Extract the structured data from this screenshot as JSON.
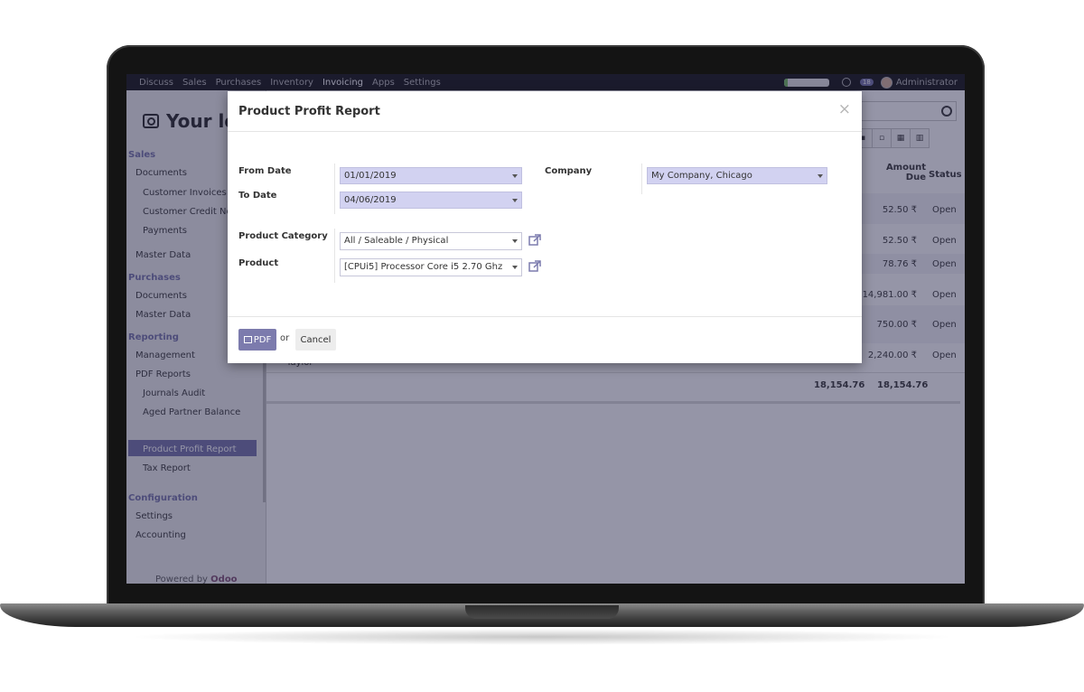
{
  "topbar": {
    "menu": [
      "Discuss",
      "Sales",
      "Purchases",
      "Inventory",
      "Invoicing",
      "Apps",
      "Settings"
    ],
    "active": "Invoicing",
    "chat_count": "18",
    "user": "Administrator"
  },
  "sidebar": {
    "logo_text": "Your lo",
    "sales": {
      "heading": "Sales",
      "documents": "Documents",
      "items": [
        "Customer Invoices",
        "Customer Credit No",
        "Payments"
      ],
      "master_data": "Master Data"
    },
    "purchases": {
      "heading": "Purchases",
      "documents": "Documents",
      "master_data": "Master Data"
    },
    "reporting": {
      "heading": "Reporting",
      "management": "Management",
      "pdf_reports": "PDF Reports",
      "items": [
        "Journals Audit",
        "Aged Partner Balance",
        "Product Profit Report",
        "Tax Report"
      ],
      "selected": "Product Profit Report"
    },
    "configuration": {
      "heading": "Configuration",
      "items": [
        "Settings",
        "Accounting"
      ]
    },
    "powered_by": "Powered by",
    "powered_brand": "Odoo"
  },
  "list": {
    "col_amount_due": [
      "Amount",
      "Due"
    ],
    "col_status": "Status",
    "rows": [
      {
        "amount": "52.50 ₹",
        "status": "Open"
      },
      {
        "amount": "52.50 ₹",
        "status": "Open"
      },
      {
        "amount": "78.76 ₹",
        "status": "Open"
      },
      {
        "amount": "14,981.00 ₹",
        "status": "Open"
      },
      {
        "amount": "750.00 ₹",
        "status": "Open"
      },
      {
        "amount": "2,240.00 ₹",
        "status": "Open"
      }
    ],
    "partial_text": "Taylor",
    "totals": [
      "18,154.76",
      "18,154.76"
    ]
  },
  "modal": {
    "title": "Product Profit Report",
    "close": "×",
    "from_date": {
      "label": "From Date",
      "value": "01/01/2019"
    },
    "to_date": {
      "label": "To Date",
      "value": "04/06/2019"
    },
    "company": {
      "label": "Company",
      "value": "My Company, Chicago"
    },
    "product_category": {
      "label": "Product Category",
      "value": "All / Saleable / Physical"
    },
    "product": {
      "label": "Product",
      "value": "[CPUi5] Processor Core i5 2.70 Ghz"
    },
    "pdf_button": "PDF",
    "or_text": "or",
    "cancel_button": "Cancel"
  },
  "colors": {
    "accent": "#7c7bad",
    "required_field": "#d2d2f1"
  }
}
